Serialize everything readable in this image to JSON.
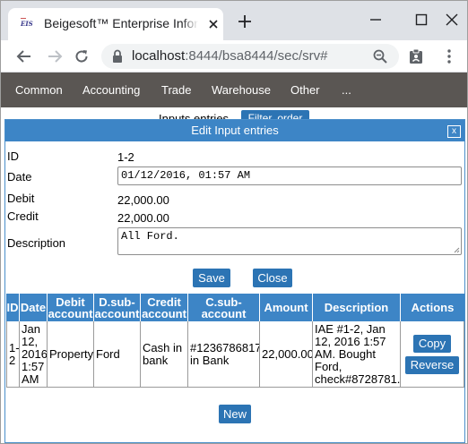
{
  "browser": {
    "tab_title": "Beigesoft™ Enterprise Information System",
    "favicon_text": "EIS",
    "url_host": "localhost",
    "url_rest": ":8444/bsa8444/sec/srv#"
  },
  "appnav": {
    "items": [
      "Common",
      "Accounting",
      "Trade",
      "Warehouse",
      "Other",
      "..."
    ]
  },
  "behind": {
    "label": "Inputs entries",
    "filter_button": "Filter, order"
  },
  "dialog": {
    "title": "Edit Input entries",
    "close": "x",
    "fields": {
      "id_label": "ID",
      "id_value": "1-2",
      "date_label": "Date",
      "date_value": "01/12/2016, 01:57 AM",
      "debit_label": "Debit",
      "debit_value": "22,000.00",
      "credit_label": "Credit",
      "credit_value": "22,000.00",
      "description_label": "Description",
      "description_value": "All Ford."
    },
    "save_button": "Save",
    "close_button": "Close",
    "new_button": "New"
  },
  "table": {
    "headers": [
      "ID",
      "Date",
      "Debit account",
      "D.sub-account",
      "Credit account",
      "C.sub-account",
      "Amount",
      "Description",
      "Actions"
    ],
    "rows": [
      {
        "id": "1-2",
        "date": "Jan 12, 2016 1:57 AM",
        "debit_account": "Property",
        "debit_sub": "Ford",
        "credit_account": "Cash in bank",
        "credit_sub": "#1236786817 in Bank",
        "amount": "22,000.00",
        "description": "IAE #1-2, Jan 12, 2016 1:57 AM. Bought Ford, check#8728781.",
        "copy": "Copy",
        "reverse": "Reverse"
      }
    ]
  }
}
